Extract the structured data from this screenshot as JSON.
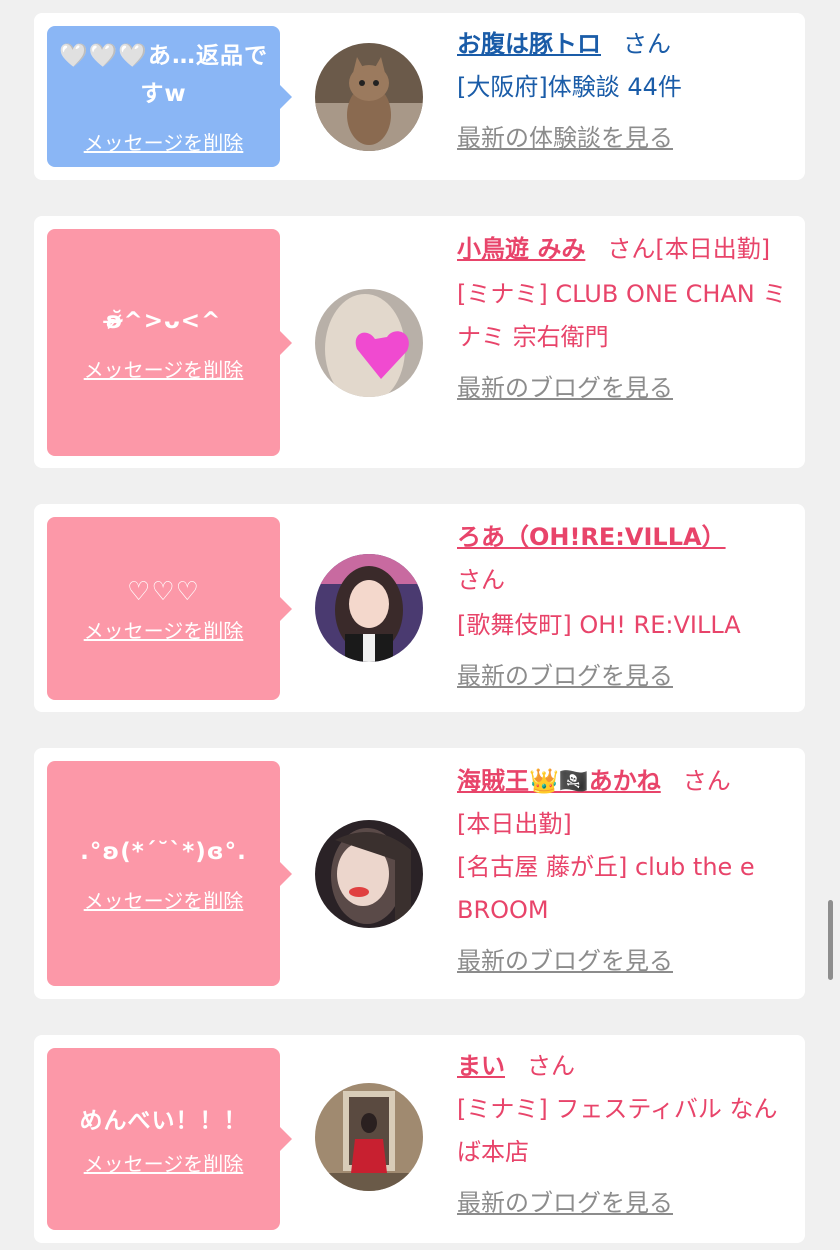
{
  "cards": [
    {
      "message": "🤍🤍🤍あ…返品ですw",
      "delete_label": "メッセージを削除",
      "name": "お腹は豚トロ",
      "honorific": "さん",
      "line2": "[大阪府]体験談 44件",
      "latest_label": "最新の体験談を見る",
      "theme": "#1a5ca8"
    },
    {
      "message": "ʚ̴̶̷̆^>ᴗ<^",
      "delete_label": "メッセージを削除",
      "name": "小鳥遊 みみ",
      "honorific": "さん[本日出勤]",
      "line2": "[ミナミ] CLUB ONE CHAN ミナミ 宗右衛門",
      "latest_label": "最新のブログを見る",
      "theme": "#e8446a"
    },
    {
      "message": "♡♡♡",
      "delete_label": "メッセージを削除",
      "name": "ろあ（OH!RE:VILLA）",
      "honorific": "さん",
      "line2": "[歌舞伎町] OH! RE:VILLA",
      "latest_label": "最新のブログを見る",
      "theme": "#e8446a"
    },
    {
      "message": ".°ʚ(*´˘`*)ɞ°.",
      "delete_label": "メッセージを削除",
      "name": "海賊王👑🏴‍☠️あかね",
      "honorific": "さん",
      "status": "[本日出勤]",
      "line2": "[名古屋 藤が丘] club the e BROOM",
      "latest_label": "最新のブログを見る",
      "theme": "#e8446a"
    },
    {
      "message": "めんべい！！！",
      "delete_label": "メッセージを削除",
      "name": "まい",
      "honorific": "さん",
      "line2": "[ミナミ] フェスティバル なんば本店",
      "latest_label": "最新のブログを見る",
      "theme": "#e8446a"
    }
  ]
}
